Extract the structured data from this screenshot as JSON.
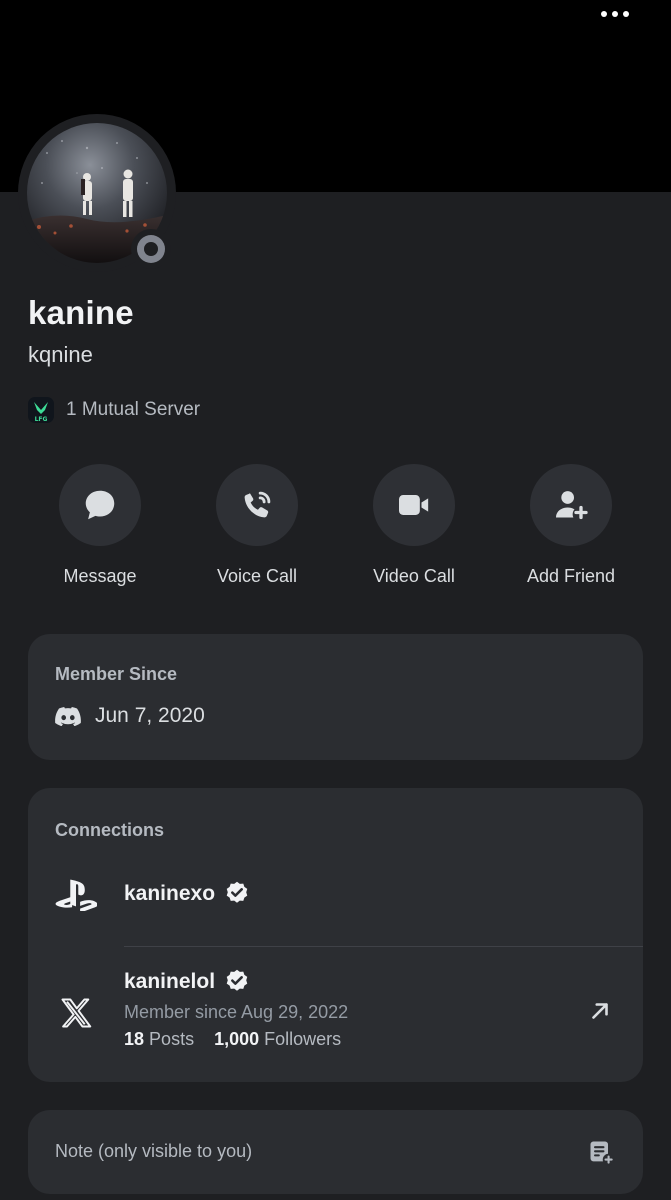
{
  "profile": {
    "display_name": "kanine",
    "username": "kqnine",
    "status": "offline"
  },
  "mutual": {
    "server_badge": "LFG",
    "text": "1 Mutual Server"
  },
  "actions": [
    {
      "label": "Message",
      "icon": "chat-bubble-icon"
    },
    {
      "label": "Voice Call",
      "icon": "phone-call-icon"
    },
    {
      "label": "Video Call",
      "icon": "video-camera-icon"
    },
    {
      "label": "Add Friend",
      "icon": "add-friend-icon"
    }
  ],
  "member_since": {
    "title": "Member Since",
    "date": "Jun 7, 2020"
  },
  "connections": {
    "title": "Connections",
    "items": [
      {
        "platform": "PlayStation",
        "name": "kaninexo",
        "verified": true
      },
      {
        "platform": "X",
        "name": "kaninelol",
        "verified": true,
        "member_since": "Member since Aug 29, 2022",
        "posts_count": "18",
        "posts_label": "Posts",
        "followers_count": "1,000",
        "followers_label": "Followers"
      }
    ]
  },
  "note": {
    "label": "Note (only visible to you)"
  },
  "colors": {
    "background": "#1e1f22",
    "card": "#2b2d31",
    "banner": "#000000",
    "button": "#2e3035",
    "server_icon_accent": "#3ddc97"
  }
}
